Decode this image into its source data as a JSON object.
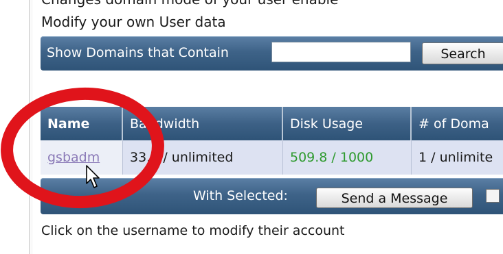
{
  "page": {
    "partial_top_text": "Changes domain mode of your user enable",
    "section_title": "Modify your own User data"
  },
  "search": {
    "label": "Show Domains that Contain",
    "input_value": "",
    "button_label": "Search"
  },
  "table": {
    "columns": [
      "Name",
      "Bandwidth",
      "Disk Usage",
      "# of Doma"
    ],
    "rows": [
      {
        "name": "gsbadm",
        "bandwidth": "33.0 / unlimited",
        "disk_usage": "509.8 / 1000",
        "domains": "1 / unlimite"
      }
    ]
  },
  "selected_bar": {
    "label": "With Selected:",
    "send_message_label": "Send a Message"
  },
  "hint": "Click on the username to modify their account",
  "colors": {
    "bar_blue": "#3e6388",
    "row_bg": "#dde2f2",
    "disk_usage_green": "#2e9a2e",
    "link_purple": "#8a79b7",
    "highlight_circle_red": "#e0141b"
  },
  "icons": {
    "cursor": "hand-pointer-cursor-icon",
    "annotation": "red-ellipse-highlight"
  }
}
